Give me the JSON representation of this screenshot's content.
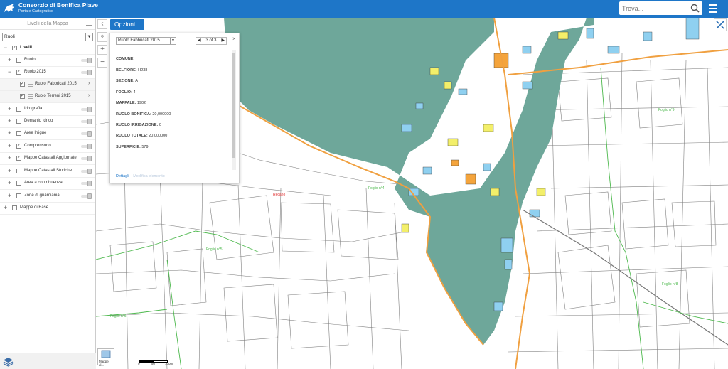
{
  "header": {
    "title": "Consorzio di Bonifica Piave",
    "subtitle": "Portale Cartografico",
    "search_placeholder": "Trova..."
  },
  "sidebar": {
    "title": "Livelli della Mappa",
    "select_value": "Ruoli",
    "layers": [
      {
        "label": "Livelli",
        "checked": true,
        "level": 0,
        "bold": true
      },
      {
        "label": "Ruolo",
        "checked": false,
        "level": 1
      },
      {
        "label": "Ruolo 2015",
        "checked": true,
        "level": 1
      },
      {
        "label": "Ruolo Fabbricati 2015",
        "checked": true,
        "level": 2
      },
      {
        "label": "Ruolo Terreni 2015",
        "checked": true,
        "level": 2
      },
      {
        "label": "Idrografia",
        "checked": false,
        "level": 1
      },
      {
        "label": "Demanio Idrico",
        "checked": false,
        "level": 1
      },
      {
        "label": "Aree Irrigue",
        "checked": false,
        "level": 1
      },
      {
        "label": "Comprensorio",
        "checked": true,
        "level": 1
      },
      {
        "label": "Mappe Catastali Aggiornate",
        "checked": true,
        "level": 1
      },
      {
        "label": "Mappe Catastali Storiche",
        "checked": false,
        "level": 1
      },
      {
        "label": "Area a contribuenza",
        "checked": false,
        "level": 1
      },
      {
        "label": "Zone di guardiania",
        "checked": false,
        "level": 1
      },
      {
        "label": "Mappe di Base",
        "checked": false,
        "level": 0
      }
    ]
  },
  "map": {
    "opzioni_label": "Opzioni...",
    "popup": {
      "select_value": "Ruolo Fabbricati 2015",
      "pager_text": "3 of 3",
      "attributes": [
        {
          "key": "COMUNE:",
          "value": ""
        },
        {
          "key": "BELFIORE:",
          "value": "H238"
        },
        {
          "key": "SEZIONE:",
          "value": "A"
        },
        {
          "key": "FOGLIO:",
          "value": "4"
        },
        {
          "key": "MAPPALE:",
          "value": "1902"
        },
        {
          "key": "RUOLO BONIFICA:",
          "value": "20,000000"
        },
        {
          "key": "RUOLO IRRIGAZIONE:",
          "value": "0"
        },
        {
          "key": "RUOLO TOTALE:",
          "value": "20,000000"
        },
        {
          "key": "SUPERFICIE:",
          "value": "579"
        }
      ],
      "link_details": "Dettagli",
      "link_edit": "Modifica elemento"
    },
    "labels": {
      "place": "Recano",
      "foglio4": "Foglio n°4",
      "foglio5": "Foglio n°5",
      "foglio6": "Foglio n°6",
      "foglio8": "Foglio n°8",
      "foglio9": "Foglio n°9"
    },
    "scale": {
      "zero": "0",
      "mid": "50",
      "end": "100m"
    },
    "basemap_button_label": "Mappe di..."
  },
  "colors": {
    "header": "#1e76c8",
    "water_body": "#6ea79a",
    "building_blue": "#8fd0f0",
    "building_yellow": "#f3ef6a",
    "building_orange": "#f4a43c",
    "road": "#f0a040",
    "boundary": "#4cb84c"
  }
}
